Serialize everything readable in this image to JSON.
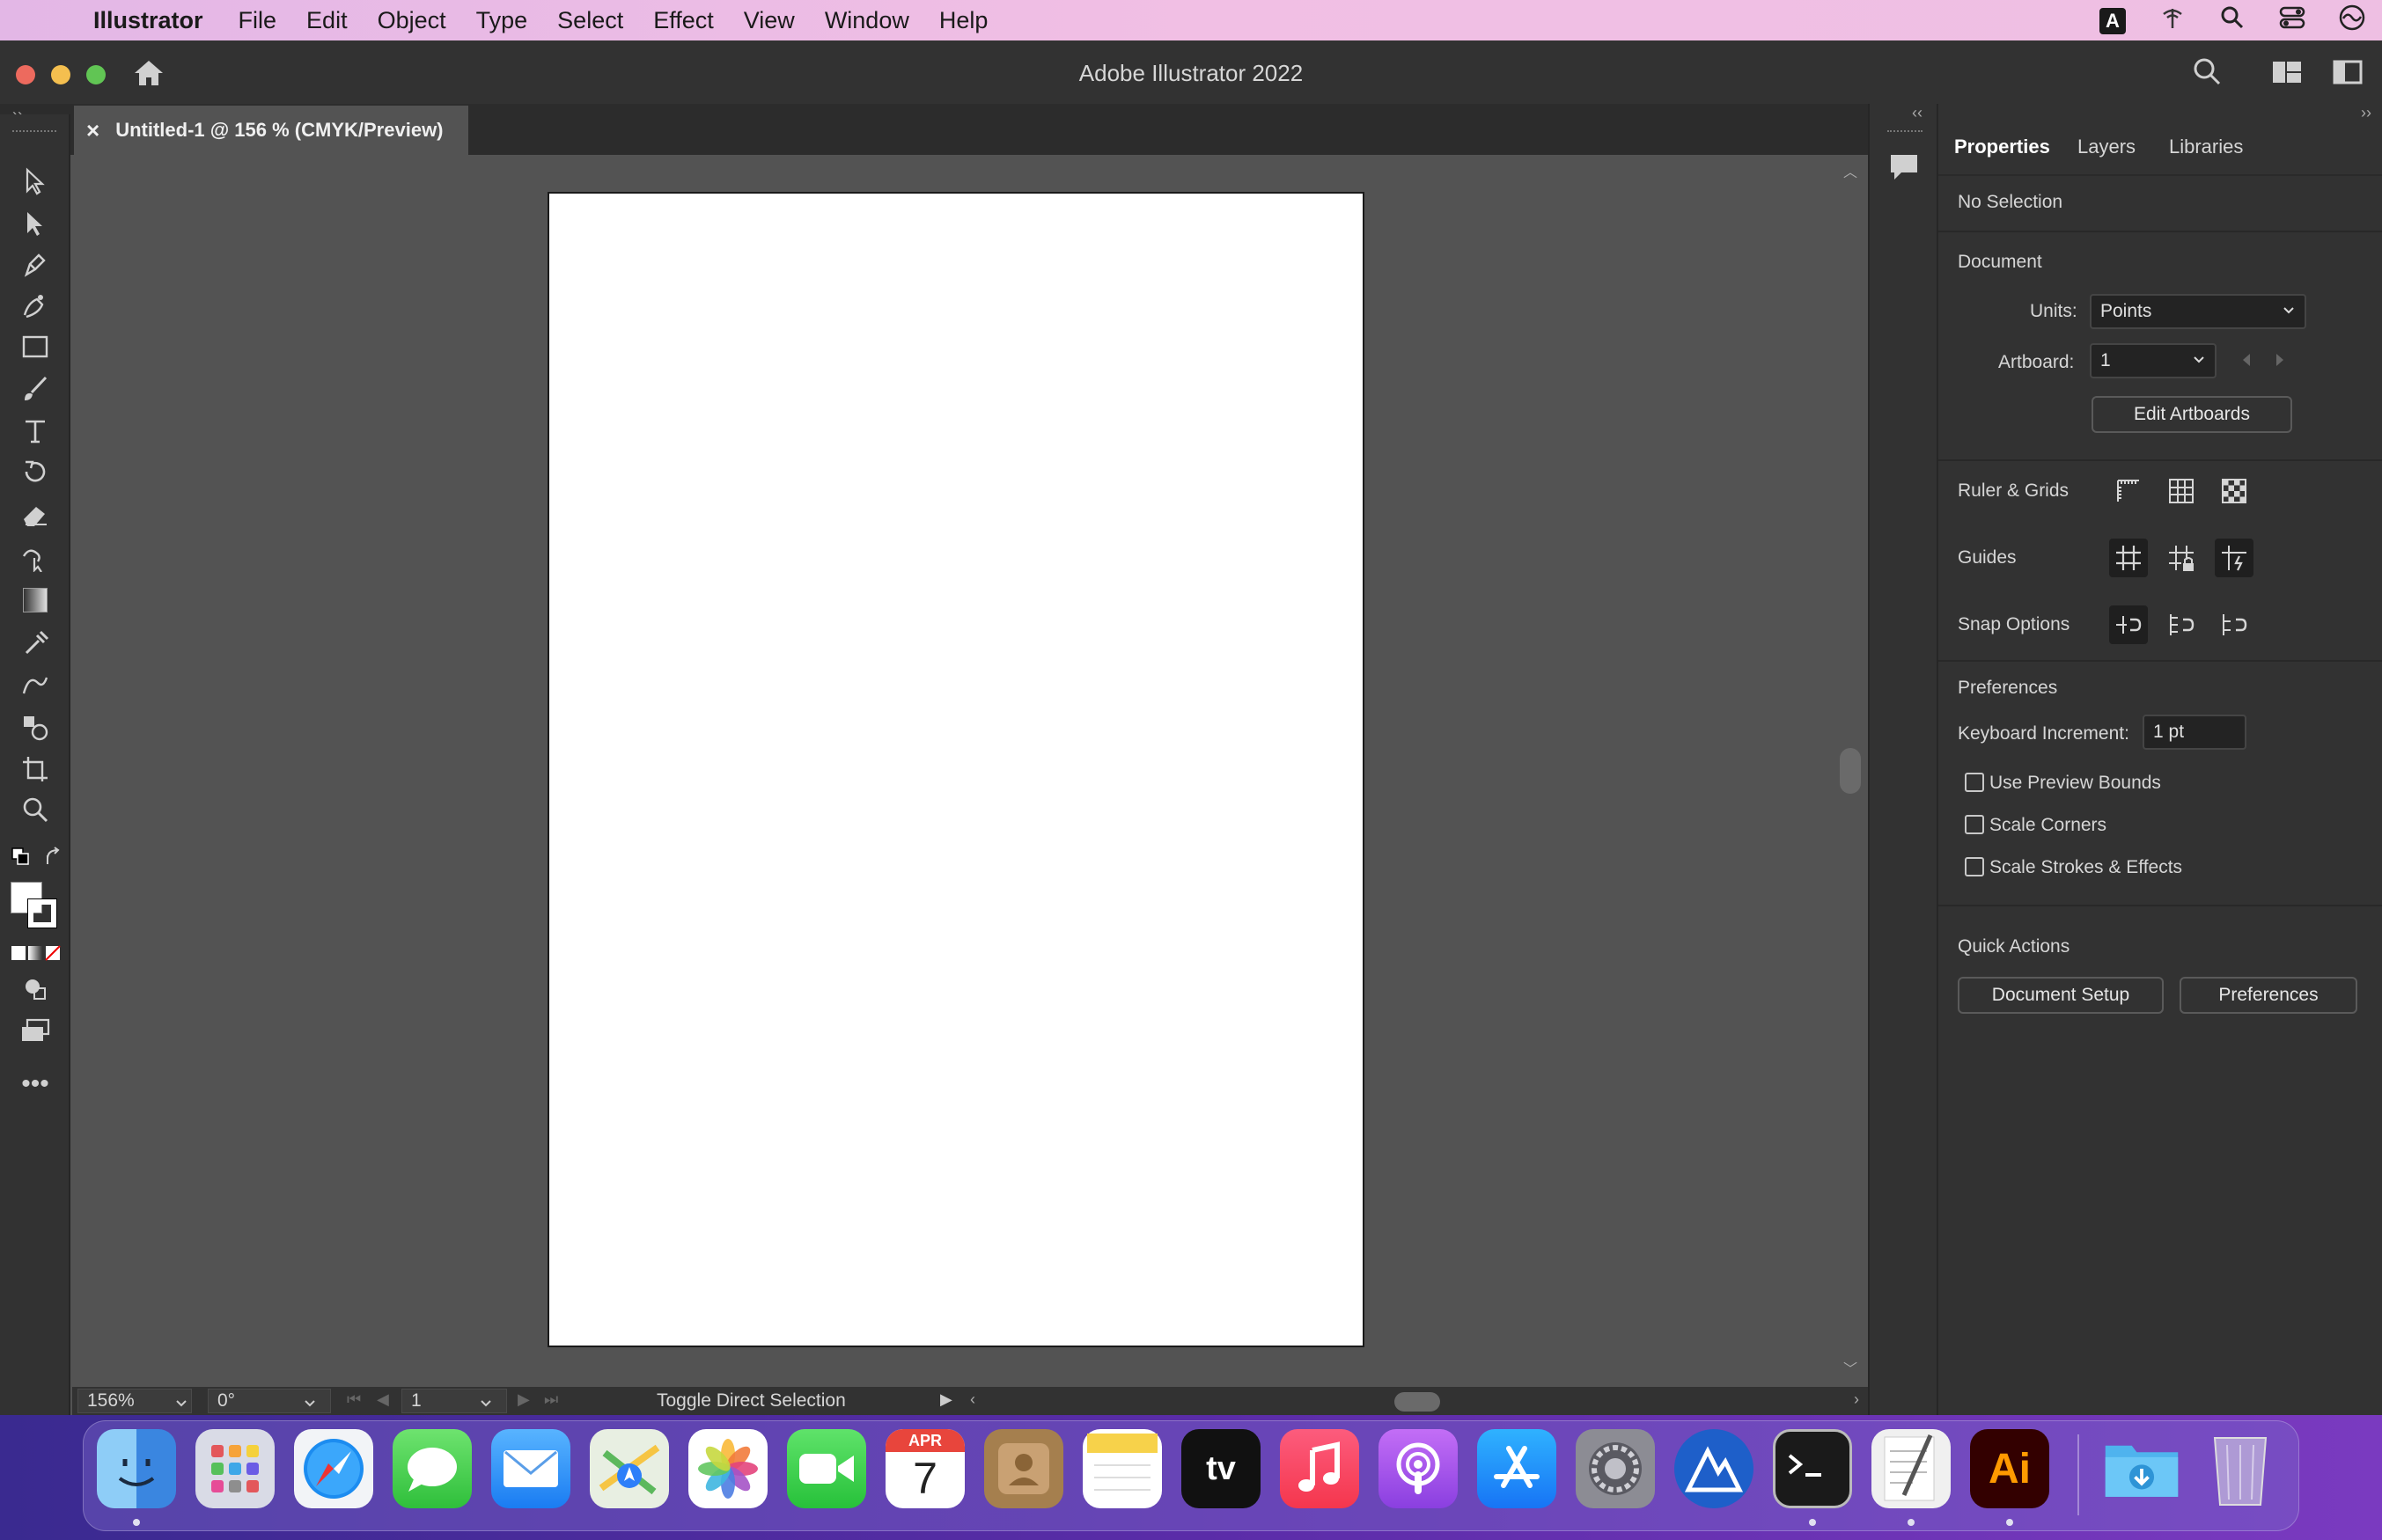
{
  "menubar": {
    "app_name": "Illustrator",
    "items": [
      "File",
      "Edit",
      "Object",
      "Type",
      "Select",
      "Effect",
      "View",
      "Window",
      "Help"
    ],
    "status_icons": [
      "text-input-icon",
      "wifi-bridge-icon",
      "spotlight-icon",
      "control-center-icon",
      "siri-icon"
    ],
    "status_glyph_input": "A"
  },
  "window": {
    "title": "Adobe Illustrator 2022"
  },
  "document_tab": {
    "title": "Untitled-1 @ 156 % (CMYK/Preview)",
    "close_glyph": "×"
  },
  "panel": {
    "tabs": [
      "Properties",
      "Layers",
      "Libraries"
    ],
    "active_tab": "Properties",
    "selection_status": "No Selection",
    "document_heading": "Document",
    "units_label": "Units:",
    "units_value": "Points",
    "artboard_label": "Artboard:",
    "artboard_value": "1",
    "edit_artboards_button": "Edit Artboards",
    "ruler_grids_label": "Ruler & Grids",
    "guides_label": "Guides",
    "snap_options_label": "Snap Options",
    "preferences_heading": "Preferences",
    "keyboard_increment_label": "Keyboard Increment:",
    "keyboard_increment_value": "1 pt",
    "checkboxes": [
      {
        "label": "Use Preview Bounds",
        "checked": false
      },
      {
        "label": "Scale Corners",
        "checked": false
      },
      {
        "label": "Scale Strokes & Effects",
        "checked": false
      }
    ],
    "quick_actions_heading": "Quick Actions",
    "document_setup_button": "Document Setup",
    "preferences_button": "Preferences"
  },
  "statusbar": {
    "zoom": "156%",
    "rotation": "0°",
    "artboard_number": "1",
    "status_text": "Toggle Direct Selection"
  },
  "dock": {
    "calendar_month": "APR",
    "calendar_day": "7",
    "tv_label": "tv",
    "illustrator_label": "Ai"
  },
  "colors": {
    "menubar_bg": "#e9bbe5",
    "app_chrome": "#323232",
    "canvas": "#535353",
    "artboard": "#ffffff",
    "accent_ai": "#ff9a00"
  }
}
